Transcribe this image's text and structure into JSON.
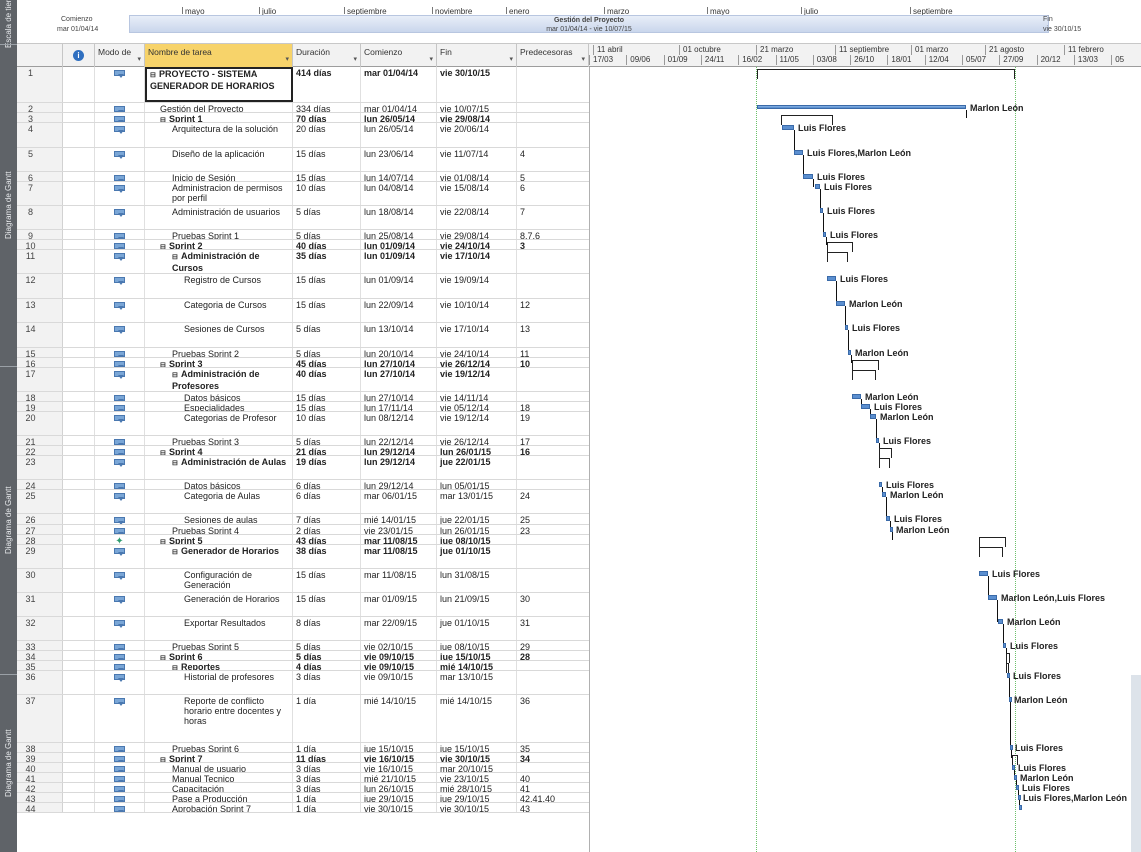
{
  "side_labels": {
    "top": "Escala de tiem",
    "g1": "Diagrama de Gantt",
    "g2": "Diagrama de Gantt",
    "g3": "Diagrama de Gantt"
  },
  "timeline": {
    "months": [
      "mayo",
      "julio",
      "septiembre",
      "noviembre",
      "enero",
      "marzo",
      "mayo",
      "julio",
      "septiembre"
    ],
    "start_label": "Comienzo",
    "start_date": "mar 01/04/14",
    "end_label": "Fin",
    "end_date": "vie 30/10/15",
    "summary_name": "Gestión del Proyecto",
    "summary_dates": "mar 01/04/14 - vie 10/07/15"
  },
  "columns": {
    "mode": "Modo de",
    "name": "Nombre de tarea",
    "duration": "Duración",
    "start": "Comienzo",
    "end": "Fin",
    "pred": "Predecesoras"
  },
  "date_header": {
    "row1": [
      "11 abril",
      "01 octubre",
      "21 marzo",
      "11 septiembre",
      "01 marzo",
      "21 agosto",
      "11 febrero"
    ],
    "row2": [
      "17/03",
      "09/06",
      "01/09",
      "24/11",
      "16/02",
      "11/05",
      "03/08",
      "26/10",
      "18/01",
      "12/04",
      "05/07",
      "27/09",
      "20/12",
      "13/03",
      "05"
    ]
  },
  "tasks": [
    {
      "id": "1",
      "name": "PROYECTO - SISTEMA GENERADOR DE HORARIOS",
      "dur": "414 días",
      "start": "mar 01/04/14",
      "end": "vie 30/10/15",
      "pred": "",
      "bold": true,
      "summary": true,
      "level": 0
    },
    {
      "id": "2",
      "name": "Gestión del Proyecto",
      "dur": "334 días",
      "start": "mar 01/04/14",
      "end": "vie 10/07/15",
      "pred": "",
      "level": 1,
      "res": "Marlon León"
    },
    {
      "id": "3",
      "name": "Sprint 1",
      "dur": "70 días",
      "start": "lun 26/05/14",
      "end": "vie 29/08/14",
      "pred": "",
      "bold": true,
      "summary": true,
      "level": 1
    },
    {
      "id": "4",
      "name": "Arquitectura de la solución",
      "dur": "20 días",
      "start": "lun 26/05/14",
      "end": "vie 20/06/14",
      "pred": "",
      "level": 2,
      "res": "Luis Flores"
    },
    {
      "id": "5",
      "name": "Diseño de la aplicación",
      "dur": "15 días",
      "start": "lun 23/06/14",
      "end": "vie 11/07/14",
      "pred": "4",
      "level": 2,
      "res": "Luis Flores,Marlon León"
    },
    {
      "id": "6",
      "name": "Inicio de Sesión",
      "dur": "15 días",
      "start": "lun 14/07/14",
      "end": "vie 01/08/14",
      "pred": "5",
      "level": 2,
      "res": "Luis Flores"
    },
    {
      "id": "7",
      "name": "Administracion de permisos por perfil",
      "dur": "10 días",
      "start": "lun 04/08/14",
      "end": "vie 15/08/14",
      "pred": "6",
      "level": 2,
      "res": "Luis Flores"
    },
    {
      "id": "8",
      "name": "Administración de usuarios",
      "dur": "5 días",
      "start": "lun 18/08/14",
      "end": "vie 22/08/14",
      "pred": "7",
      "level": 2,
      "res": "Luis Flores"
    },
    {
      "id": "9",
      "name": "Pruebas Sprint 1",
      "dur": "5 días",
      "start": "lun 25/08/14",
      "end": "vie 29/08/14",
      "pred": "8,7,6",
      "level": 2,
      "res": "Luis Flores"
    },
    {
      "id": "10",
      "name": "Sprint 2",
      "dur": "40 días",
      "start": "lun 01/09/14",
      "end": "vie 24/10/14",
      "pred": "3",
      "bold": true,
      "summary": true,
      "level": 1
    },
    {
      "id": "11",
      "name": "Administración de Cursos",
      "dur": "35 días",
      "start": "lun 01/09/14",
      "end": "vie 17/10/14",
      "pred": "",
      "bold": true,
      "summary": true,
      "level": 2
    },
    {
      "id": "12",
      "name": "Registro de Cursos",
      "dur": "15 días",
      "start": "lun 01/09/14",
      "end": "vie 19/09/14",
      "pred": "",
      "level": 3,
      "res": "Luis Flores"
    },
    {
      "id": "13",
      "name": "Categoria de Cursos",
      "dur": "15 días",
      "start": "lun 22/09/14",
      "end": "vie 10/10/14",
      "pred": "12",
      "level": 3,
      "res": "Marlon León"
    },
    {
      "id": "14",
      "name": "Sesiones de Cursos",
      "dur": "5 días",
      "start": "lun 13/10/14",
      "end": "vie 17/10/14",
      "pred": "13",
      "level": 3,
      "res": "Luis Flores"
    },
    {
      "id": "15",
      "name": "Pruebas Sprint 2",
      "dur": "5 días",
      "start": "lun 20/10/14",
      "end": "vie 24/10/14",
      "pred": "11",
      "level": 2,
      "res": "Marlon León"
    },
    {
      "id": "16",
      "name": "Sprint 3",
      "dur": "45 días",
      "start": "lun 27/10/14",
      "end": "vie 26/12/14",
      "pred": "10",
      "bold": true,
      "summary": true,
      "level": 1
    },
    {
      "id": "17",
      "name": "Administración de Profesores",
      "dur": "40 días",
      "start": "lun 27/10/14",
      "end": "vie 19/12/14",
      "pred": "",
      "bold": true,
      "summary": true,
      "level": 2
    },
    {
      "id": "18",
      "name": "Datos básicos",
      "dur": "15 días",
      "start": "lun 27/10/14",
      "end": "vie 14/11/14",
      "pred": "",
      "level": 3,
      "res": "Marlon León"
    },
    {
      "id": "19",
      "name": "Especialidades",
      "dur": "15 días",
      "start": "lun 17/11/14",
      "end": "vie 05/12/14",
      "pred": "18",
      "level": 3,
      "res": "Luis Flores"
    },
    {
      "id": "20",
      "name": "Categorias de Profesor",
      "dur": "10 días",
      "start": "lun 08/12/14",
      "end": "vie 19/12/14",
      "pred": "19",
      "level": 3,
      "res": "Marlon León"
    },
    {
      "id": "21",
      "name": "Pruebas Sprint 3",
      "dur": "5 días",
      "start": "lun 22/12/14",
      "end": "vie 26/12/14",
      "pred": "17",
      "level": 2,
      "res": "Luis Flores"
    },
    {
      "id": "22",
      "name": "Sprint 4",
      "dur": "21 días",
      "start": "lun 29/12/14",
      "end": "lun 26/01/15",
      "pred": "16",
      "bold": true,
      "summary": true,
      "level": 1
    },
    {
      "id": "23",
      "name": "Administración de Aulas",
      "dur": "19 días",
      "start": "lun 29/12/14",
      "end": "jue 22/01/15",
      "pred": "",
      "bold": true,
      "summary": true,
      "level": 2
    },
    {
      "id": "24",
      "name": "Datos básicos",
      "dur": "6 días",
      "start": "lun 29/12/14",
      "end": "lun 05/01/15",
      "pred": "",
      "level": 3,
      "res": "Luis Flores"
    },
    {
      "id": "25",
      "name": "Categoria de Aulas",
      "dur": "6 días",
      "start": "mar 06/01/15",
      "end": "mar 13/01/15",
      "pred": "24",
      "level": 3,
      "res": "Marlon León"
    },
    {
      "id": "26",
      "name": "Sesiones de aulas",
      "dur": "7 días",
      "start": "mié 14/01/15",
      "end": "jue 22/01/15",
      "pred": "25",
      "level": 3,
      "res": "Luis Flores"
    },
    {
      "id": "27",
      "name": "Pruebas Sprint 4",
      "dur": "2 días",
      "start": "vie 23/01/15",
      "end": "lun 26/01/15",
      "pred": "23",
      "level": 2,
      "res": "Marlon León"
    },
    {
      "id": "28",
      "name": "Sprint 5",
      "dur": "43 días",
      "start": "mar 11/08/15",
      "end": "jue 08/10/15",
      "pred": "",
      "bold": true,
      "summary": true,
      "level": 1,
      "pin": true
    },
    {
      "id": "29",
      "name": "Generador de Horarios",
      "dur": "38 días",
      "start": "mar 11/08/15",
      "end": "jue 01/10/15",
      "pred": "",
      "bold": true,
      "summary": true,
      "level": 2
    },
    {
      "id": "30",
      "name": "Configuración de Generación",
      "dur": "15 días",
      "start": "mar 11/08/15",
      "end": "lun 31/08/15",
      "pred": "",
      "level": 3,
      "res": "Luis Flores"
    },
    {
      "id": "31",
      "name": "Generación de Horarios",
      "dur": "15 días",
      "start": "mar 01/09/15",
      "end": "lun 21/09/15",
      "pred": "30",
      "level": 3,
      "res": "Marlon León,Luis Flores"
    },
    {
      "id": "32",
      "name": "Exportar Resultados",
      "dur": "8 días",
      "start": "mar 22/09/15",
      "end": "jue 01/10/15",
      "pred": "31",
      "level": 3,
      "res": "Marlon León"
    },
    {
      "id": "33",
      "name": "Pruebas Sprint 5",
      "dur": "5 días",
      "start": "vie 02/10/15",
      "end": "jue 08/10/15",
      "pred": "29",
      "level": 2,
      "res": "Luis Flores"
    },
    {
      "id": "34",
      "name": "Sprint 6",
      "dur": "5 días",
      "start": "vie 09/10/15",
      "end": "jue 15/10/15",
      "pred": "28",
      "bold": true,
      "summary": true,
      "level": 1
    },
    {
      "id": "35",
      "name": "Reportes",
      "dur": "4 días",
      "start": "vie 09/10/15",
      "end": "mié 14/10/15",
      "pred": "",
      "bold": true,
      "summary": true,
      "level": 2
    },
    {
      "id": "36",
      "name": "Historial de profesores",
      "dur": "3 días",
      "start": "vie 09/10/15",
      "end": "mar 13/10/15",
      "pred": "",
      "level": 3,
      "res": "Luis Flores"
    },
    {
      "id": "37",
      "name": "Reporte de conflicto horario entre docentes y horas",
      "dur": "1 día",
      "start": "mié 14/10/15",
      "end": "mié 14/10/15",
      "pred": "36",
      "level": 3,
      "res": "Marlon León"
    },
    {
      "id": "38",
      "name": "Pruebas Sprint 6",
      "dur": "1 día",
      "start": "jue 15/10/15",
      "end": "jue 15/10/15",
      "pred": "35",
      "level": 2,
      "res": "Luis Flores"
    },
    {
      "id": "39",
      "name": "Sprint 7",
      "dur": "11 días",
      "start": "vie 16/10/15",
      "end": "vie 30/10/15",
      "pred": "34",
      "bold": true,
      "summary": true,
      "level": 1
    },
    {
      "id": "40",
      "name": "Manual de usuario",
      "dur": "3 días",
      "start": "vie 16/10/15",
      "end": "mar 20/10/15",
      "pred": "",
      "level": 2,
      "res": "Luis Flores"
    },
    {
      "id": "41",
      "name": "Manual Tecnico",
      "dur": "3 días",
      "start": "mié 21/10/15",
      "end": "vie 23/10/15",
      "pred": "40",
      "level": 2,
      "res": "Marlon León"
    },
    {
      "id": "42",
      "name": "Capacitación",
      "dur": "3 días",
      "start": "lun 26/10/15",
      "end": "mié 28/10/15",
      "pred": "41",
      "level": 2,
      "res": "Luis Flores"
    },
    {
      "id": "43",
      "name": "Pase a Producción",
      "dur": "1 día",
      "start": "jue 29/10/15",
      "end": "jue 29/10/15",
      "pred": "42,41,40",
      "level": 2,
      "res": "Luis Flores,Marlon León"
    },
    {
      "id": "44",
      "name": "Aprobación Sprint 7",
      "dur": "1 día",
      "start": "vie 30/10/15",
      "end": "vie 30/10/15",
      "pred": "43",
      "level": 2
    }
  ]
}
